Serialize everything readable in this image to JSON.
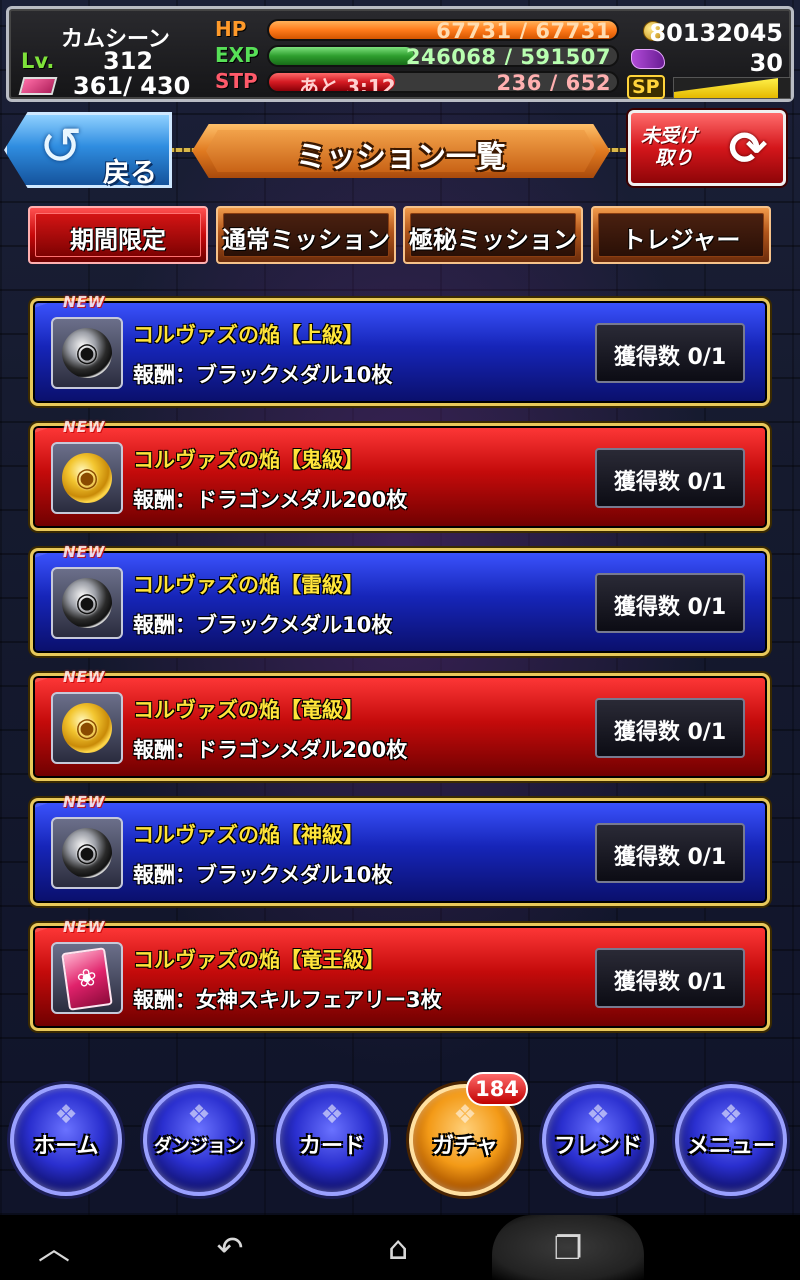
{
  "status": {
    "name": "カムシーン",
    "lv_label": "Lv.",
    "lv": "312",
    "stone": "361/ 430",
    "hp_label": "HP",
    "hp_text": "67731 / 67731",
    "hp_fill": 1.0,
    "exp_label": "EXP",
    "exp_text": "246068 / 591507",
    "exp_fill": 0.416,
    "stp_label": "STP",
    "stp_timer": "あと 3:12",
    "stp_text": "236 / 652",
    "stp_fill": 0.362,
    "coins": "80132045",
    "ship_count": "30",
    "sp_label": "SP",
    "sp_fill": 0.9,
    "colors": {
      "hp": "#ff7a1a",
      "exp": "#3fbf3f",
      "stp": "#e0222a"
    }
  },
  "header": {
    "back_label": "戻る",
    "back_icon": "back-arrow-icon",
    "title": "ミッション一覧",
    "receive_label_line1": "未受け",
    "receive_label_line2": "取り",
    "receive_icon": "refresh-icon"
  },
  "tabs": [
    {
      "label": "期間限定",
      "active": true
    },
    {
      "label": "通常ミッション",
      "active": false
    },
    {
      "label": "極秘ミッション",
      "active": false
    },
    {
      "label": "トレジャー",
      "active": false
    }
  ],
  "missions": [
    {
      "new": "NEW",
      "title": "コルヴァズの焔【上級】",
      "reward": "報酬：ブラックメダル10枚",
      "count": "獲得数 0/1",
      "color": "blue",
      "icon": "black-medal-icon"
    },
    {
      "new": "NEW",
      "title": "コルヴァズの焔【鬼級】",
      "reward": "報酬：ドラゴンメダル200枚",
      "count": "獲得数 0/1",
      "color": "red",
      "icon": "dragon-medal-icon"
    },
    {
      "new": "NEW",
      "title": "コルヴァズの焔【雷級】",
      "reward": "報酬：ブラックメダル10枚",
      "count": "獲得数 0/1",
      "color": "blue",
      "icon": "black-medal-icon"
    },
    {
      "new": "NEW",
      "title": "コルヴァズの焔【竜級】",
      "reward": "報酬：ドラゴンメダル200枚",
      "count": "獲得数 0/1",
      "color": "red",
      "icon": "dragon-medal-icon"
    },
    {
      "new": "NEW",
      "title": "コルヴァズの焔【神級】",
      "reward": "報酬：ブラックメダル10枚",
      "count": "獲得数 0/1",
      "color": "blue",
      "icon": "black-medal-icon"
    },
    {
      "new": "NEW",
      "title": "コルヴァズの焔【竜王級】",
      "reward": "報酬：女神スキルフェアリー3枚",
      "count": "獲得数 0/1",
      "color": "red",
      "icon": "fairy-card-icon"
    }
  ],
  "menu": {
    "home": "ホーム",
    "dungeon": "ダンジョン",
    "card": "カード",
    "gacha": "ガチャ",
    "gacha_badge": "184",
    "friend": "フレンド",
    "menu": "メニュー"
  },
  "android_nav": {
    "up_icon": "chevron-up-icon",
    "back_icon": "back-icon",
    "home_icon": "home-icon",
    "recent_icon": "recent-apps-icon"
  }
}
